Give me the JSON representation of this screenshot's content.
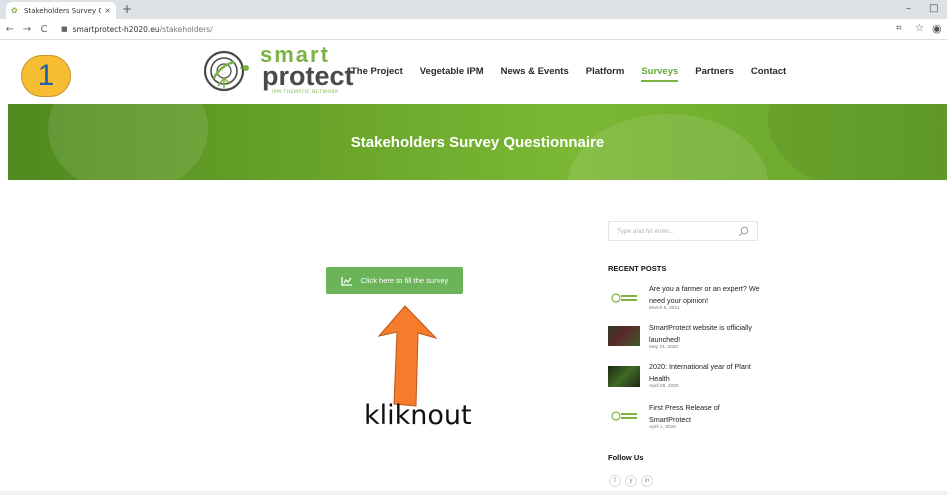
{
  "browser": {
    "tab_title": "Stakeholders Survey Questionnai",
    "tab_close": "×",
    "new_tab": "+",
    "url_domain": "smartprotect-h2020.eu",
    "url_path": "/stakeholders/",
    "nav_back": "←",
    "nav_forward": "→",
    "nav_reload": "C",
    "win_min": "–",
    "win_restore": "□"
  },
  "annotation": {
    "step_number": "1",
    "label": "kliknout",
    "arrow_color": "#f47c2a"
  },
  "logo": {
    "word_smart": "smart",
    "word_protect": "protect",
    "subtitle": "IPM THEMATIC NETWORK",
    "brand_green": "#7cb342"
  },
  "nav": {
    "items": [
      {
        "label": "The Project",
        "active": false
      },
      {
        "label": "Vegetable IPM",
        "active": false
      },
      {
        "label": "News & Events",
        "active": false
      },
      {
        "label": "Platform",
        "active": false
      },
      {
        "label": "Surveys",
        "active": true
      },
      {
        "label": "Partners",
        "active": false
      },
      {
        "label": "Contact",
        "active": false
      }
    ]
  },
  "hero": {
    "title": "Stakeholders Survey Questionnaire"
  },
  "main": {
    "cta_label": "Click here to fill the survey",
    "cta_color": "#6bb45a"
  },
  "sidebar": {
    "search_placeholder": "Type and hit enter...",
    "recent_heading": "RECENT POSTS",
    "posts": [
      {
        "title": "Are you a farmer or an expert? We need your opinion!",
        "date": "March 8, 2021",
        "thumb": "logo"
      },
      {
        "title": "SmartProtect website is officially launched!",
        "date": "May 21, 2020",
        "thumb": "photo"
      },
      {
        "title": "2020: International year of Plant Health",
        "date": "April 28, 2020",
        "thumb": "photo"
      },
      {
        "title": "First Press Release of SmartProtect",
        "date": "April 1, 2020",
        "thumb": "logo"
      }
    ],
    "follow_heading": "Follow Us",
    "social": [
      {
        "icon": "facebook-icon",
        "glyph": "f"
      },
      {
        "icon": "twitter-icon",
        "glyph": "y"
      },
      {
        "icon": "linkedin-icon",
        "glyph": "in"
      }
    ]
  }
}
